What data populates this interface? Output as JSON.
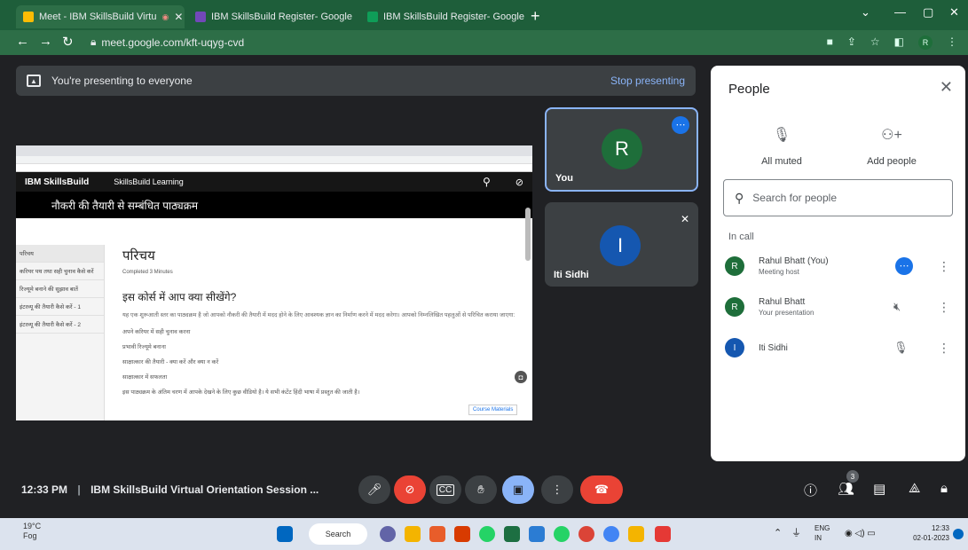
{
  "browser": {
    "tabs": [
      {
        "label": "Meet - IBM SkillsBuild Virtu",
        "active": true
      },
      {
        "label": "IBM SkillsBuild Register- Google",
        "active": false
      },
      {
        "label": "IBM SkillsBuild Register- Google",
        "active": false
      }
    ],
    "url": "meet.google.com/kft-uqyg-cvd",
    "profile_initial": "R"
  },
  "banner": {
    "text": "You're presenting to everyone",
    "stop_label": "Stop presenting"
  },
  "shared_screen": {
    "brand": "IBM SkillsBuild",
    "subbrand": "SkillsBuild Learning",
    "course_title": "नौकरी की तैयारी से सम्बंधित पाठ्यक्रम",
    "sidebar_items": [
      "परिचय",
      "करियर पथ तथा सही चुनाव कैसे करें",
      "रिज्यूमे बनाने की सुझाव बातें",
      "इंटरव्यू की तैयारी कैसे करें - 1",
      "इंटरव्यू की तैयारी कैसे करें - 2"
    ],
    "heading": "परिचय",
    "meta": "Completed   3 Minutes",
    "subheading": "इस कोर्स में आप क्या सीखेंगे?",
    "paragraph": "यह एक शुरूआती स्तर का पाठ्यक्रम है जो आपको नौकरी की तैयारी में मदद होने के लिए आवश्यक ज्ञान का निर्माण करने में मदद करेगा। आपको निम्नलिखित पहलुओं से परिचित कराया जाएगा:",
    "bullets": [
      "अपने करियर में सही चुनाव करना",
      "प्रभावी रिज्यूमे बनाना",
      "साक्षात्कार की तैयारी - क्या करें और क्या न करें",
      "साक्षात्कार में सफलता"
    ],
    "footer_line": "इस पाठ्यक्रम के अंतिम चरण में आपके देखने के लिए कुछ वीडियो है। ये सभी कंटेंट हिंदी भाषा में प्रस्तुत की जाती है।",
    "side_button": "Course Materials"
  },
  "tiles": {
    "you": {
      "initial": "R",
      "name": "You",
      "color": "#1e6e3a"
    },
    "iti": {
      "initial": "I",
      "name": "Iti Sidhi",
      "color": "#1557b0"
    }
  },
  "people_panel": {
    "title": "People",
    "all_muted": "All muted",
    "add_people": "Add people",
    "search_placeholder": "Search for people",
    "in_call": "In call",
    "participants": [
      {
        "initial": "R",
        "name": "Rahul Bhatt (You)",
        "sub": "Meeting host",
        "color": "#1e6e3a"
      },
      {
        "initial": "R",
        "name": "Rahul Bhatt",
        "sub": "Your presentation",
        "color": "#1e6e3a"
      },
      {
        "initial": "I",
        "name": "Iti Sidhi",
        "sub": "",
        "color": "#1557b0"
      }
    ]
  },
  "bottom_bar": {
    "time": "12:33 PM",
    "meeting_title": "IBM SkillsBuild Virtual Orientation Session ...",
    "people_count": "3"
  },
  "taskbar": {
    "temp": "19°C",
    "weather": "Fog",
    "search": "Search",
    "lang1": "ENG",
    "lang2": "IN",
    "clock_time": "12:33",
    "clock_date": "02-01-2023"
  }
}
